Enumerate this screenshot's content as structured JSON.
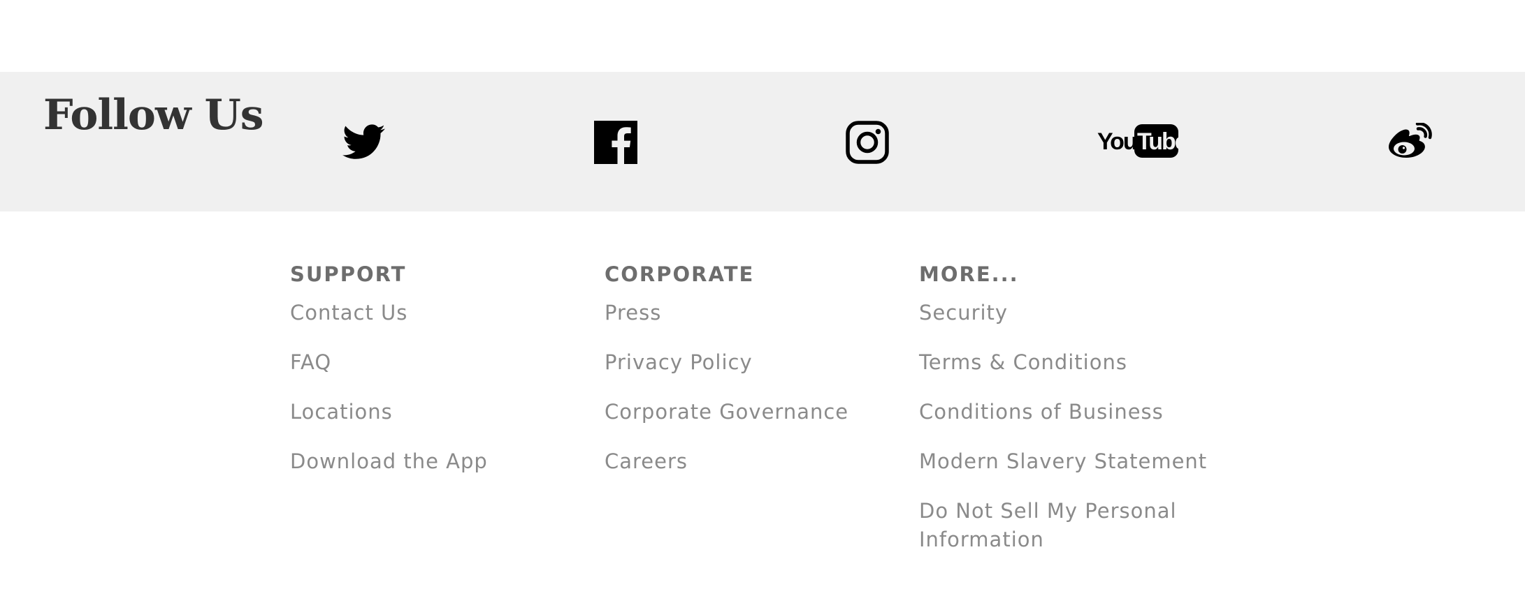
{
  "follow": {
    "title": "Follow Us",
    "social": [
      {
        "name": "twitter",
        "icon": "twitter-icon"
      },
      {
        "name": "facebook",
        "icon": "facebook-icon"
      },
      {
        "name": "instagram",
        "icon": "instagram-icon"
      },
      {
        "name": "youtube",
        "icon": "youtube-icon"
      },
      {
        "name": "weibo",
        "icon": "weibo-icon"
      }
    ]
  },
  "footer": {
    "columns": [
      {
        "heading": "SUPPORT",
        "links": [
          "Contact Us",
          "FAQ",
          "Locations",
          "Download the App"
        ]
      },
      {
        "heading": "CORPORATE",
        "links": [
          "Press",
          "Privacy Policy",
          "Corporate Governance",
          "Careers"
        ]
      },
      {
        "heading": "MORE...",
        "links": [
          "Security",
          "Terms & Conditions",
          "Conditions of Business",
          "Modern Slavery Statement",
          "Do Not Sell My Personal Information"
        ]
      }
    ]
  },
  "colors": {
    "follow_bar_bg": "#f0f0f0",
    "heading": "#6d6d6d",
    "link": "#8a8a8a",
    "icon": "#000000"
  }
}
